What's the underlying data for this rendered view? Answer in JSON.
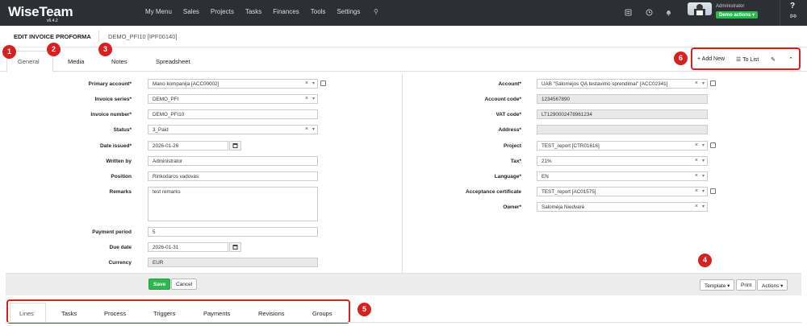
{
  "brand": {
    "name": "WiseTeam",
    "version": "v6.4.2"
  },
  "menu": [
    "My Menu",
    "Sales",
    "Projects",
    "Tasks",
    "Finances",
    "Tools",
    "Settings"
  ],
  "user": {
    "name": "Administrator",
    "demo_actions": "Demo actions ▾"
  },
  "header": {
    "title": "EDIT INVOICE PROFORMA",
    "record": "DEMO_PFI10 [IPF00140]"
  },
  "tabs": [
    "General",
    "Media",
    "Notes",
    "Spreadsheet"
  ],
  "toolbar": {
    "add_new": "+ Add New",
    "to_list": "To List"
  },
  "badges": [
    "1",
    "2",
    "3",
    "4",
    "5",
    "6"
  ],
  "left_form": {
    "primary_account": {
      "label": "Primary account*",
      "value": "Mano kompanija [ACC00002]"
    },
    "invoice_series": {
      "label": "Invoice series*",
      "value": "DEMO_PFI"
    },
    "invoice_number": {
      "label": "Invoice number*",
      "value": "DEMO_PFI10"
    },
    "status": {
      "label": "Status*",
      "value": "3_Paid"
    },
    "date_issued": {
      "label": "Date issued*",
      "value": "2026-01-26"
    },
    "written_by": {
      "label": "Written by",
      "value": "Administrator"
    },
    "position": {
      "label": "Position",
      "value": "Rinkodaros vadovas"
    },
    "remarks": {
      "label": "Remarks",
      "value": "test remarks"
    },
    "payment_period": {
      "label": "Payment period",
      "value": "5"
    },
    "due_date": {
      "label": "Due date",
      "value": "2026-01-31"
    },
    "currency": {
      "label": "Currency",
      "value": "EUR"
    }
  },
  "right_form": {
    "account": {
      "label": "Account*",
      "value": "UAB \"Salomejos QA testavimo sprendimai\" [ACC02341]"
    },
    "account_code": {
      "label": "Account code*",
      "value": "1234567890"
    },
    "vat_code": {
      "label": "VAT code*",
      "value": "LT1290002478961234"
    },
    "address": {
      "label": "Address*",
      "value": ""
    },
    "project": {
      "label": "Project",
      "value": "TEST_report [CTR01616]"
    },
    "tax": {
      "label": "Tax*",
      "value": "21%"
    },
    "language": {
      "label": "Language*",
      "value": "EN"
    },
    "acceptance_certificate": {
      "label": "Acceptance certificate",
      "value": "TEST_report [AC01575]"
    },
    "owner": {
      "label": "Owner*",
      "value": "Salomėja Niedvarė"
    }
  },
  "buttons": {
    "save": "Save",
    "cancel": "Cancel",
    "template": "Template ▾",
    "print": "Print",
    "actions": "Actions ▾"
  },
  "subtabs": [
    "Lines",
    "Tasks",
    "Process",
    "Triggers",
    "Payments",
    "Revisions",
    "Groups"
  ],
  "colors": {
    "topbar": "#2c2f33",
    "accent_green": "#2db84d",
    "annotation_red": "#d72020"
  }
}
